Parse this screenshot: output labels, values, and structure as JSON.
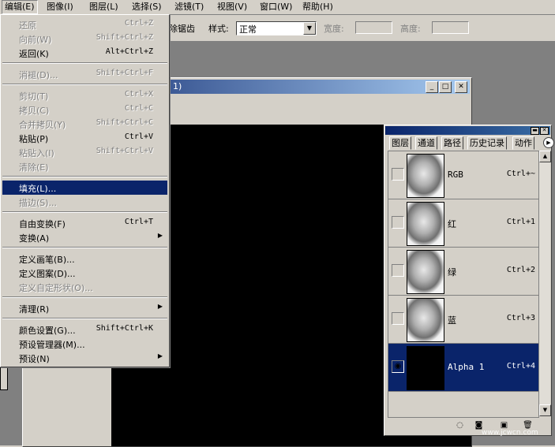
{
  "menubar": {
    "items": [
      "编辑(E)",
      "图像(I)",
      "图层(L)",
      "选择(S)",
      "滤镜(T)",
      "视图(V)",
      "窗口(W)",
      "帮助(H)"
    ]
  },
  "options": {
    "antialias_label": "除锯齿",
    "style_label": "样式:",
    "style_value": "正常",
    "width_label": "宽度:",
    "height_label": "高度:"
  },
  "document": {
    "title": "1)"
  },
  "edit_menu": {
    "items": [
      {
        "label": "还原",
        "shortcut": "Ctrl+Z"
      },
      {
        "label": "向前(W)",
        "shortcut": "Shift+Ctrl+Z"
      },
      {
        "label": "返回(K)",
        "shortcut": "Alt+Ctrl+Z"
      },
      {
        "label": "消褪(D)...",
        "shortcut": "Shift+Ctrl+F"
      },
      {
        "label": "剪切(T)",
        "shortcut": "Ctrl+X"
      },
      {
        "label": "拷贝(C)",
        "shortcut": "Ctrl+C"
      },
      {
        "label": "合并拷贝(Y)",
        "shortcut": "Shift+Ctrl+C"
      },
      {
        "label": "粘贴(P)",
        "shortcut": "Ctrl+V"
      },
      {
        "label": "粘贴入(I)",
        "shortcut": "Shift+Ctrl+V"
      },
      {
        "label": "清除(E)",
        "shortcut": ""
      },
      {
        "label": "填充(L)...",
        "shortcut": ""
      },
      {
        "label": "描边(S)...",
        "shortcut": ""
      },
      {
        "label": "自由变换(F)",
        "shortcut": "Ctrl+T"
      },
      {
        "label": "变换(A)",
        "shortcut": ""
      },
      {
        "label": "定义画笔(B)...",
        "shortcut": ""
      },
      {
        "label": "定义图案(D)...",
        "shortcut": ""
      },
      {
        "label": "定义自定形状(O)...",
        "shortcut": ""
      },
      {
        "label": "清理(R)",
        "shortcut": ""
      },
      {
        "label": "颜色设置(G)...",
        "shortcut": "Shift+Ctrl+K"
      },
      {
        "label": "预设管理器(M)...",
        "shortcut": ""
      },
      {
        "label": "预设(N)",
        "shortcut": ""
      }
    ]
  },
  "palette": {
    "tabs": [
      "图层",
      "通道",
      "路径",
      "历史记录",
      "动作"
    ],
    "channels": [
      {
        "name": "RGB",
        "shortcut": "Ctrl+~"
      },
      {
        "name": "红",
        "shortcut": "Ctrl+1"
      },
      {
        "name": "绿",
        "shortcut": "Ctrl+2"
      },
      {
        "name": "蓝",
        "shortcut": "Ctrl+3"
      },
      {
        "name": "Alpha 1",
        "shortcut": "Ctrl+4"
      }
    ]
  },
  "watermark": "www.jcwcn.com",
  "colors": {
    "highlight": "#0a246a",
    "chrome": "#d4d0c8",
    "workspace": "#808080"
  }
}
